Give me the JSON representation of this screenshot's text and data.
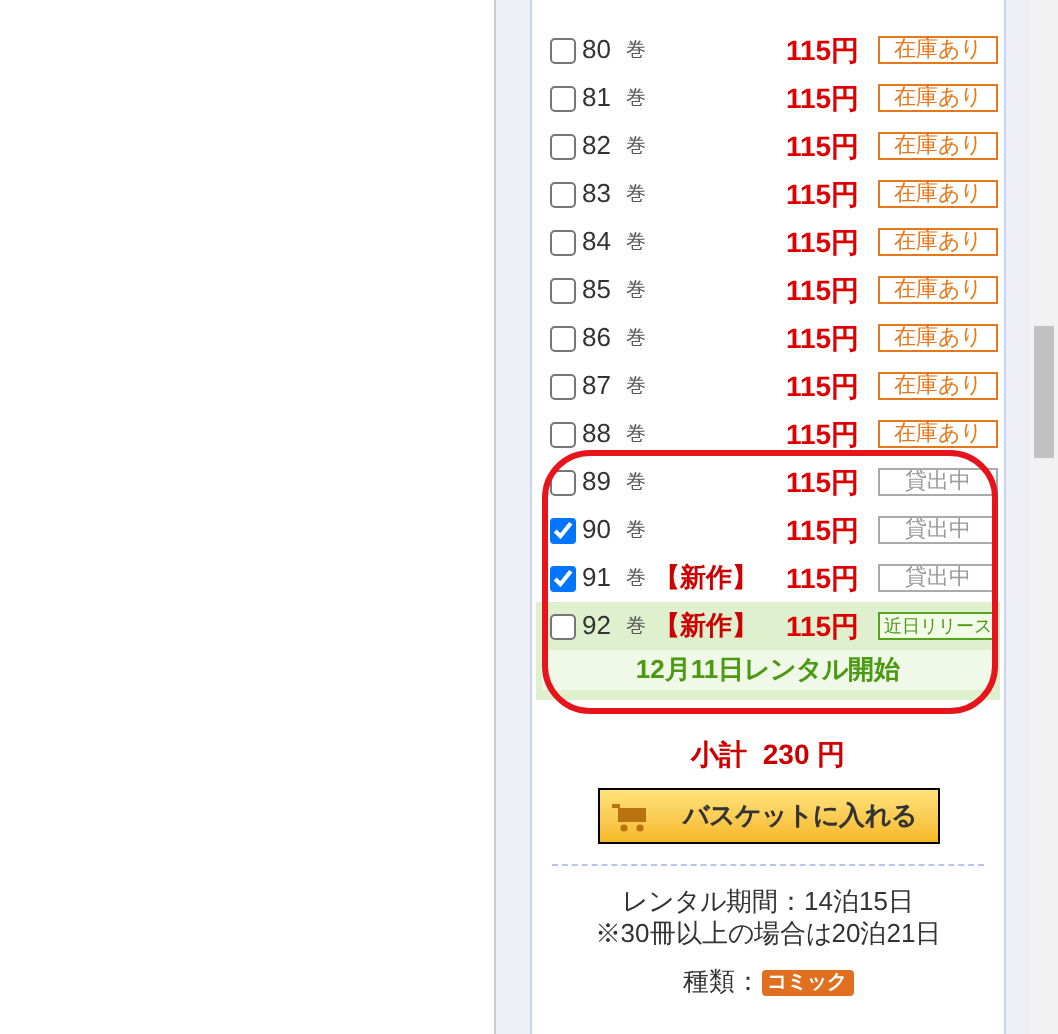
{
  "volumes": [
    {
      "number": "80",
      "unit": "巻",
      "price": "115円",
      "status": {
        "kind": "in_stock",
        "text": "在庫あり"
      },
      "checked": false
    },
    {
      "number": "81",
      "unit": "巻",
      "price": "115円",
      "status": {
        "kind": "in_stock",
        "text": "在庫あり"
      },
      "checked": false
    },
    {
      "number": "82",
      "unit": "巻",
      "price": "115円",
      "status": {
        "kind": "in_stock",
        "text": "在庫あり"
      },
      "checked": false
    },
    {
      "number": "83",
      "unit": "巻",
      "price": "115円",
      "status": {
        "kind": "in_stock",
        "text": "在庫あり"
      },
      "checked": false
    },
    {
      "number": "84",
      "unit": "巻",
      "price": "115円",
      "status": {
        "kind": "in_stock",
        "text": "在庫あり"
      },
      "checked": false
    },
    {
      "number": "85",
      "unit": "巻",
      "price": "115円",
      "status": {
        "kind": "in_stock",
        "text": "在庫あり"
      },
      "checked": false
    },
    {
      "number": "86",
      "unit": "巻",
      "price": "115円",
      "status": {
        "kind": "in_stock",
        "text": "在庫あり"
      },
      "checked": false
    },
    {
      "number": "87",
      "unit": "巻",
      "price": "115円",
      "status": {
        "kind": "in_stock",
        "text": "在庫あり"
      },
      "checked": false
    },
    {
      "number": "88",
      "unit": "巻",
      "price": "115円",
      "status": {
        "kind": "in_stock",
        "text": "在庫あり"
      },
      "checked": false
    },
    {
      "number": "89",
      "unit": "巻",
      "price": "115円",
      "status": {
        "kind": "rented",
        "text": "貸出中"
      },
      "checked": false
    },
    {
      "number": "90",
      "unit": "巻",
      "price": "115円",
      "status": {
        "kind": "rented",
        "text": "貸出中"
      },
      "checked": true
    },
    {
      "number": "91",
      "unit": "巻",
      "new_label": "【新作】",
      "price": "115円",
      "status": {
        "kind": "rented",
        "text": "貸出中"
      },
      "checked": true
    },
    {
      "number": "92",
      "unit": "巻",
      "new_label": "【新作】",
      "price": "115円",
      "status": {
        "kind": "upcoming",
        "text": "近日リリース"
      },
      "checked": false,
      "release_note": "12月11日レンタル開始"
    }
  ],
  "subtotal": {
    "label": "小計",
    "amount": "230 円"
  },
  "basket_button": "バスケットに入れる",
  "rental_period": "レンタル期間：14泊15日",
  "rental_note": "※30冊以上の場合は20泊21日",
  "genre": {
    "label": "種類：",
    "tag": "コミック"
  }
}
